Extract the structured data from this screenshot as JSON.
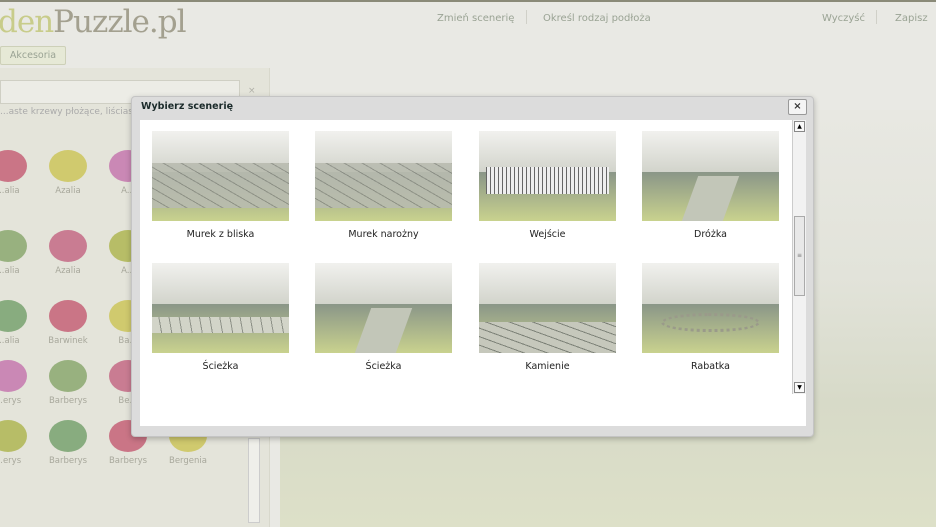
{
  "header": {
    "logo_main": "den",
    "logo_rest": "Puzzle.pl",
    "nav": [
      "Zmień scenerię",
      "Określ rodzaj podłoża"
    ],
    "actions": [
      "Wyczyść",
      "Zapisz"
    ]
  },
  "sidebar": {
    "tab": "Akcesoria",
    "description": "...aste krzewy płożące, liściaste ...\n...y...",
    "plants": [
      [
        "...alia",
        "Azalia",
        "A..."
      ],
      [
        "...alia",
        "Azalia",
        "A..."
      ],
      [
        "...alia",
        "Barwinek",
        "Ba..."
      ],
      [
        "...erys",
        "Barberys",
        "Be..."
      ],
      [
        "...erys",
        "Barberys",
        "Barberys",
        "Bergenia"
      ]
    ]
  },
  "modal": {
    "title": "Wybierz scenerię",
    "close": "×",
    "scenes": [
      {
        "label": "Murek z bliska",
        "kind": "wall"
      },
      {
        "label": "Murek narożny",
        "kind": "wall"
      },
      {
        "label": "Wejście",
        "kind": "fence"
      },
      {
        "label": "Dróżka",
        "kind": "road"
      },
      {
        "label": "Ścieżka",
        "kind": "path"
      },
      {
        "label": "Ścieżka",
        "kind": "road"
      },
      {
        "label": "Kamienie",
        "kind": "stones"
      },
      {
        "label": "Rabatka",
        "kind": "ring"
      }
    ]
  }
}
